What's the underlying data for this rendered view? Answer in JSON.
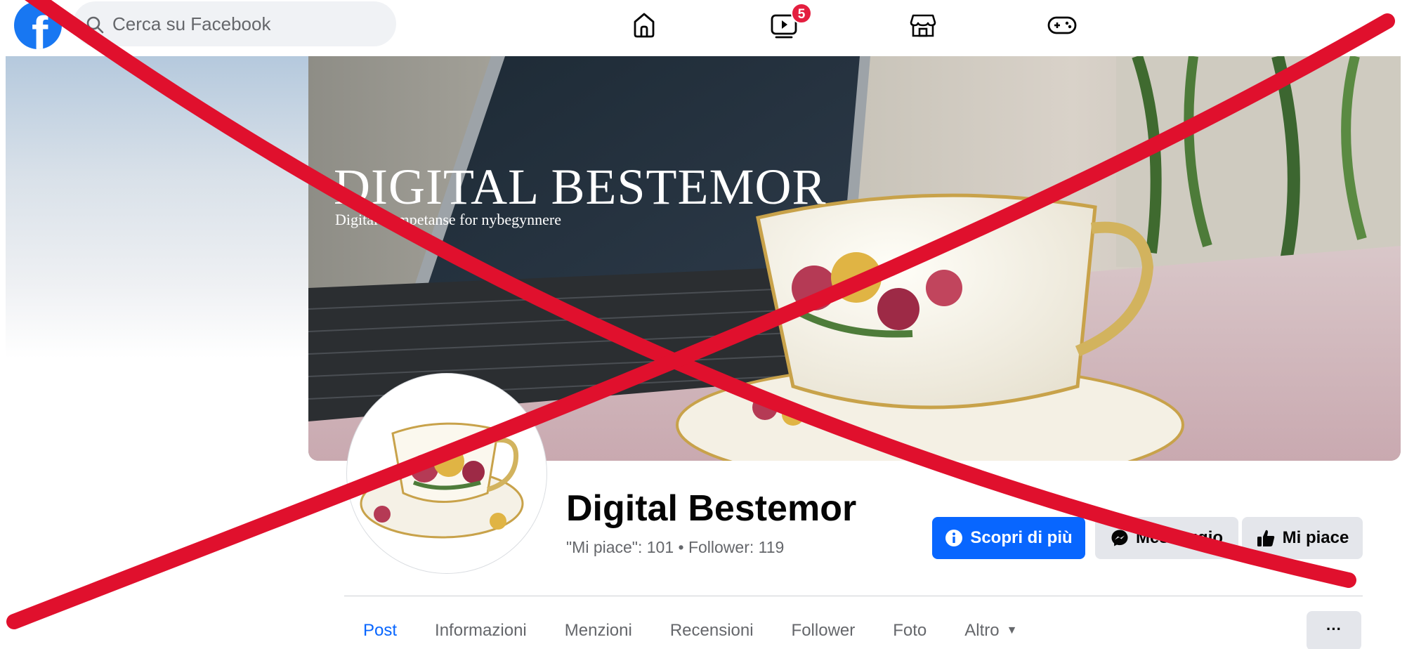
{
  "search": {
    "placeholder": "Cerca su Facebook"
  },
  "nav": {
    "icons": [
      "home-icon",
      "video-icon",
      "marketplace-icon",
      "gaming-icon"
    ],
    "video_badge": "5"
  },
  "cover": {
    "title": "DIGITAL BESTEMOR",
    "subtitle": "Digital kompetanse for nybegynnere"
  },
  "page": {
    "name": "Digital Bestemor",
    "stats": "\"Mi piace\": 101 • Follower: 119"
  },
  "actions": {
    "learn_more": "Scopri di più",
    "message": "Messaggio",
    "like": "Mi piace"
  },
  "tabs": {
    "post": "Post",
    "info": "Informazioni",
    "mentions": "Menzioni",
    "reviews": "Recensioni",
    "followers": "Follower",
    "photos": "Foto",
    "more": "Altro",
    "overflow": "···"
  },
  "colors": {
    "brand": "#1877f2",
    "primary_button": "#0866ff",
    "badge": "#e41e3f",
    "overlay_x": "#e0102d"
  }
}
